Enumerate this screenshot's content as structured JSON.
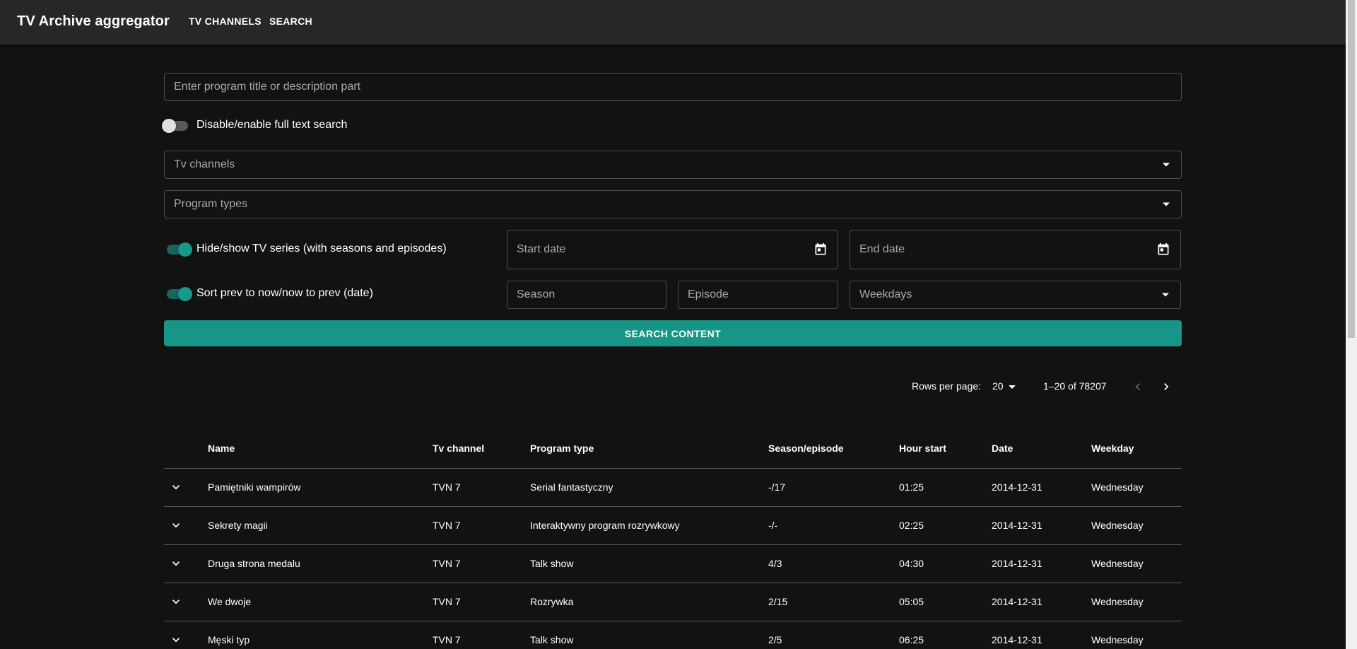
{
  "app": {
    "title": "TV Archive aggregator",
    "nav": [
      "TV CHANNELS",
      "SEARCH"
    ]
  },
  "form": {
    "query_placeholder": "Enter program title or description part",
    "fulltext_toggle_label": "Disable/enable full text search",
    "fulltext_enabled": false,
    "channels_placeholder": "Tv channels",
    "program_types_placeholder": "Program types",
    "series_toggle_label": "Hide/show TV series (with seasons and episodes)",
    "series_enabled": true,
    "sort_toggle_label": "Sort prev to now/now to prev (date)",
    "sort_enabled": true,
    "start_date_placeholder": "Start date",
    "end_date_placeholder": "End date",
    "season_placeholder": "Season",
    "episode_placeholder": "Episode",
    "weekdays_placeholder": "Weekdays",
    "search_button": "SEARCH CONTENT"
  },
  "pagination": {
    "rows_per_page_label": "Rows per page:",
    "rows_per_page": "20",
    "range": "1–20 of 78207"
  },
  "table": {
    "columns": [
      "Name",
      "Tv channel",
      "Program type",
      "Season/episode",
      "Hour start",
      "Date",
      "Weekday"
    ],
    "rows": [
      [
        "Pamiętniki wampirów",
        "TVN 7",
        "Serial fantastyczny",
        "-/17",
        "01:25",
        "2014-12-31",
        "Wednesday"
      ],
      [
        "Sekrety magii",
        "TVN 7",
        "Interaktywny program rozrywkowy",
        "-/-",
        "02:25",
        "2014-12-31",
        "Wednesday"
      ],
      [
        "Druga strona medalu",
        "TVN 7",
        "Talk show",
        "4/3",
        "04:30",
        "2014-12-31",
        "Wednesday"
      ],
      [
        "We dwoje",
        "TVN 7",
        "Rozrywka",
        "2/15",
        "05:05",
        "2014-12-31",
        "Wednesday"
      ],
      [
        "Męski typ",
        "TVN 7",
        "Talk show",
        "2/5",
        "06:25",
        "2014-12-31",
        "Wednesday"
      ]
    ]
  },
  "icons": {
    "calendar": "calendar-icon",
    "dropdown": "arrow-drop-down-icon",
    "expand": "chevron-down-icon",
    "prev": "chevron-left-icon",
    "next": "chevron-right-icon"
  },
  "colors": {
    "accent": "#179587",
    "background": "#121212",
    "appbar": "#272727"
  }
}
